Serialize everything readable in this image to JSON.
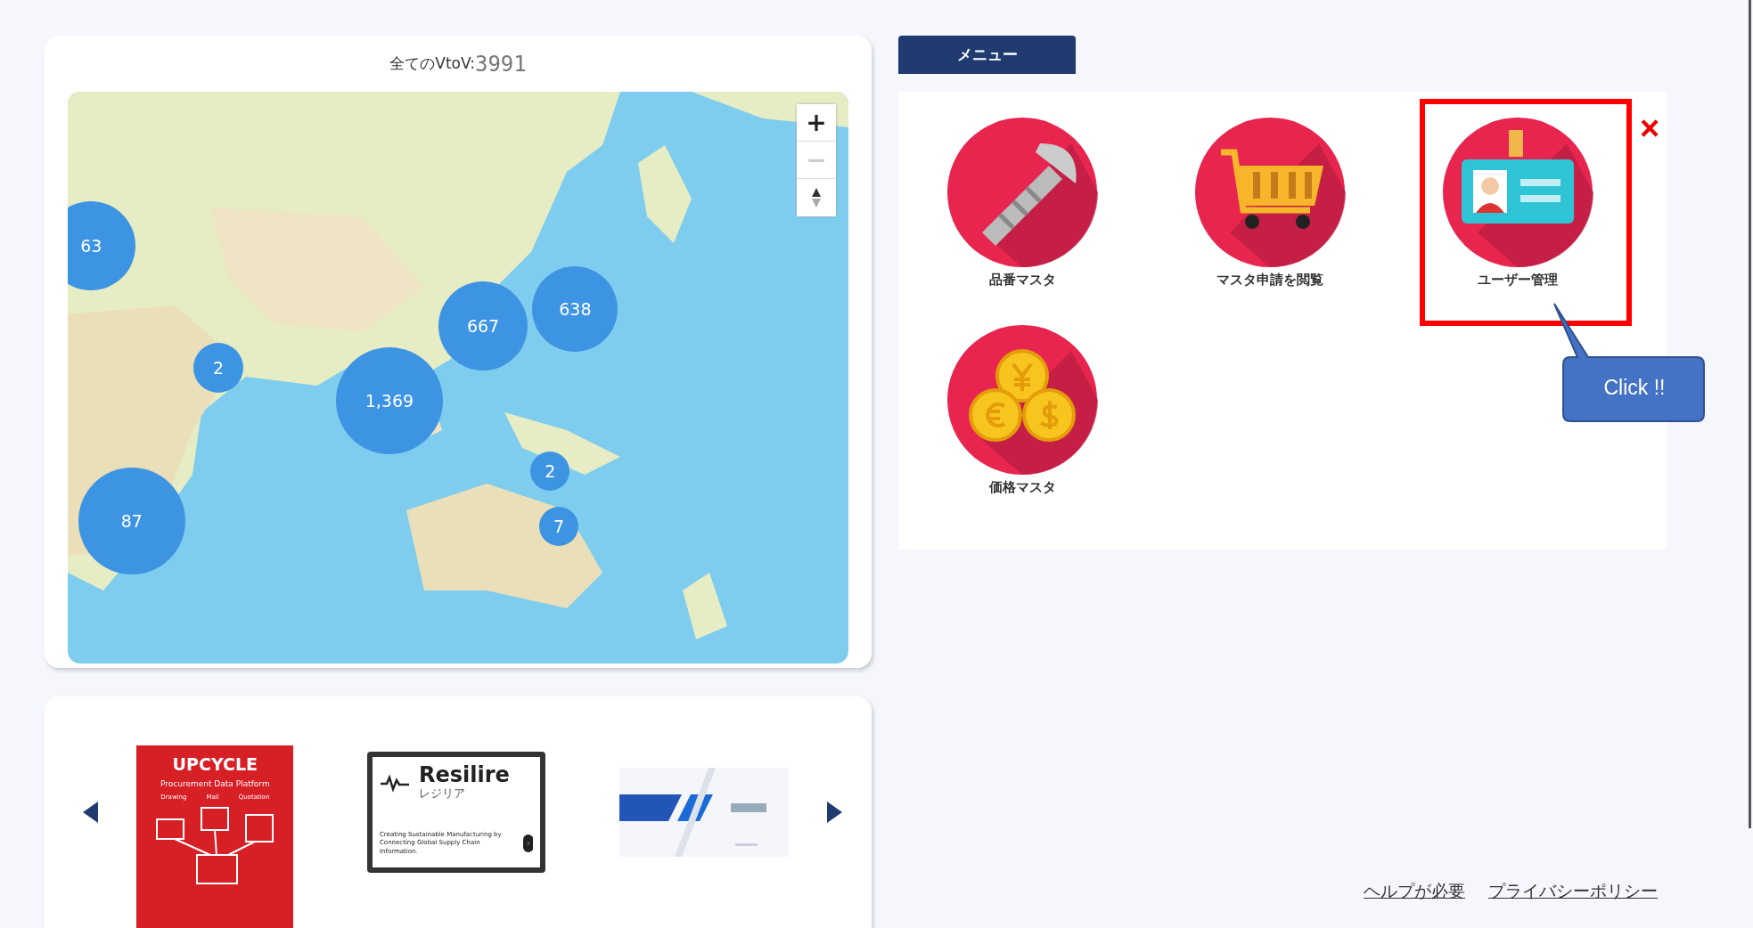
{
  "map_card": {
    "title": "全てのVtoV:",
    "count": "3991",
    "clusters": [
      {
        "label": "63"
      },
      {
        "label": "2"
      },
      {
        "label": "1,369"
      },
      {
        "label": "667"
      },
      {
        "label": "638"
      },
      {
        "label": "2"
      },
      {
        "label": "7"
      },
      {
        "label": "87"
      }
    ],
    "zoom_controls": [
      {
        "label": "+",
        "disabled": false
      },
      {
        "label": "−",
        "disabled": true
      }
    ]
  },
  "carousel": {
    "banners": [
      {
        "kind": "upcycle",
        "title": "UPCYCLE",
        "subtitle": "Procurement Data Platform",
        "labels": [
          "Drawing",
          "Mail",
          "Quotation"
        ]
      },
      {
        "kind": "resilire",
        "title": "Resilire",
        "subtitle": "レジリア",
        "text": "Creating Sustainable Manufacturing by Connecting Global Supply Chain Information."
      },
      {
        "kind": "picture"
      }
    ]
  },
  "menu": {
    "tab": "メニュー",
    "close": "×",
    "items": [
      {
        "kind": "screw",
        "label": "品番マスタ",
        "highlighted": false
      },
      {
        "kind": "cart",
        "label": "マスタ申請を閲覧",
        "highlighted": false
      },
      {
        "kind": "badge",
        "label": "ユーザー管理",
        "highlighted": true,
        "callout": "Click !!"
      },
      {
        "kind": "coins",
        "label": "価格マスタ",
        "highlighted": false
      }
    ]
  },
  "footer_links": [
    "ヘルプが必要",
    "プライバシーポリシー"
  ]
}
